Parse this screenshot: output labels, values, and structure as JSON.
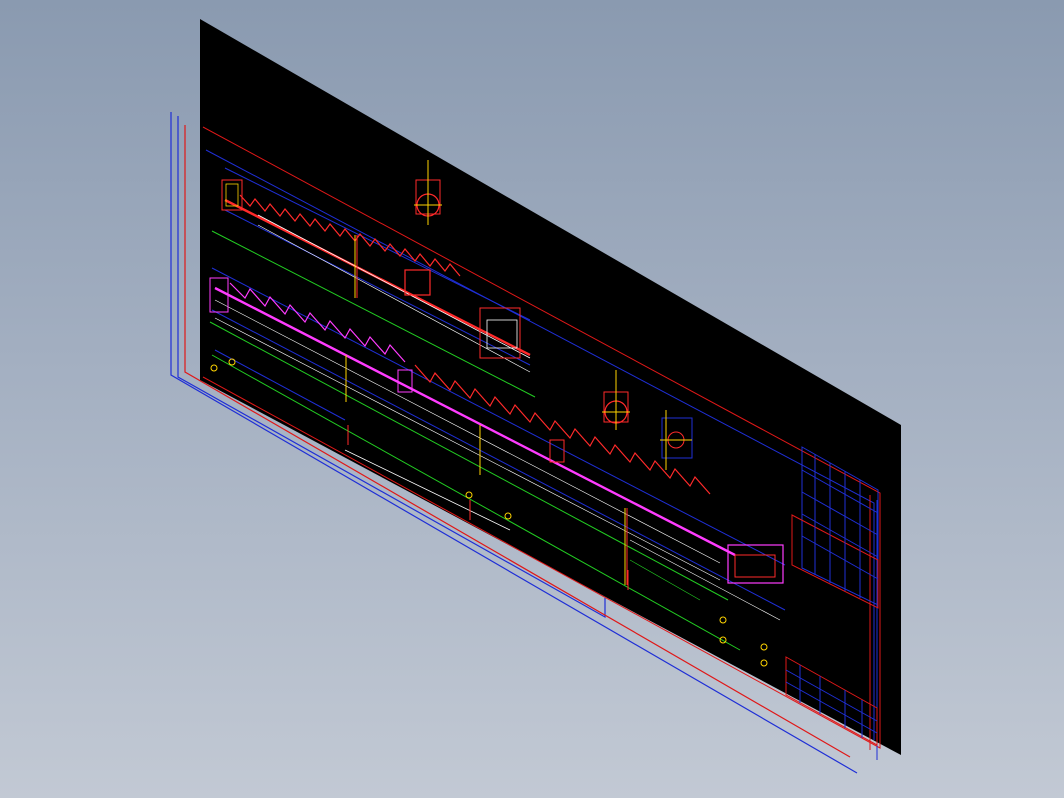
{
  "viewport": {
    "name": "3d-model-viewport",
    "background_top": "#8a9ab0",
    "background_bottom": "#c2c9d4"
  },
  "drawing": {
    "sheet_color": "#000000",
    "colors": {
      "frame_blue": "#1f2fd6",
      "frame_red": "#e01818",
      "part_red": "#ff2a2a",
      "part_magenta": "#ff3cff",
      "centerline_green": "#22cc22",
      "dimension_white": "#ffffff",
      "accent_yellow": "#ffd400"
    },
    "components": [
      "drawing-sheet",
      "outer-frame-blue",
      "outer-frame-red",
      "conveyor-view-top",
      "conveyor-view-bottom",
      "section-view-top",
      "section-view-middle",
      "section-view-right",
      "title-block",
      "revision-table"
    ]
  }
}
